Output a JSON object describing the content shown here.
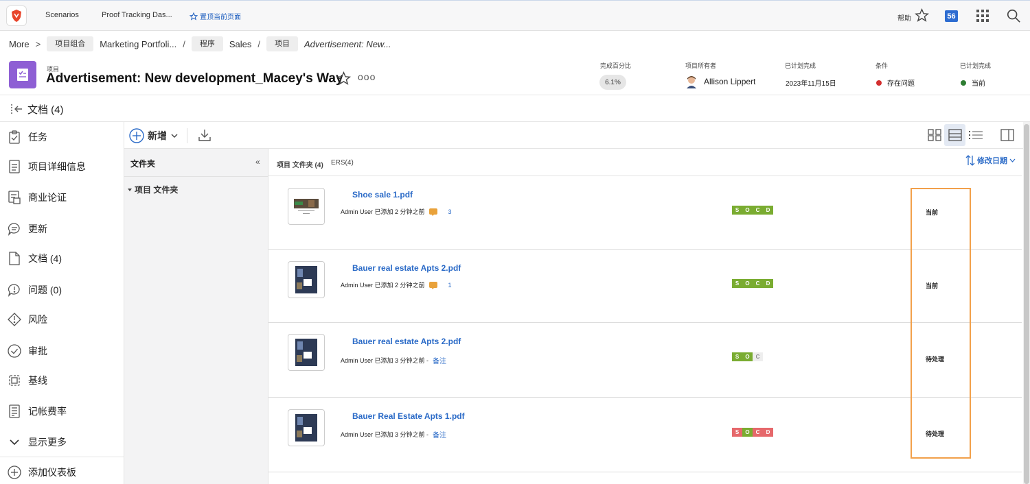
{
  "topnav": {
    "links": [
      "Scenarios",
      "Proof Tracking Das..."
    ],
    "pin_label": "置顶当前页面",
    "help": "帮助",
    "notifications": "56"
  },
  "breadcrumb": {
    "more": "More",
    "portfolio_chip": "项目组合",
    "portfolio": "Marketing Portfoli...",
    "program_chip": "程序",
    "program": "Sales",
    "project_chip": "项目",
    "current": "Advertisement: New..."
  },
  "header": {
    "type": "项目",
    "title": "Advertisement: New development_Macey's Way",
    "more": "ooo",
    "percent_label": "完成百分比",
    "percent": "6.1%",
    "owner_label": "项目所有者",
    "owner": "Allison Lippert",
    "planned_label": "已计划完成",
    "planned": "2023年11月15日",
    "condition_label": "条件",
    "condition": "存在问题",
    "condition_color": "#d32f2f",
    "planned2_label": "已计划完成",
    "planned2": "当前",
    "planned2_color": "#2e7d32"
  },
  "section": {
    "title": "文档 (4)"
  },
  "leftnav": {
    "items": [
      {
        "label": "任务",
        "icon": "clipboard-check-icon"
      },
      {
        "label": "项目详细信息",
        "icon": "document-icon"
      },
      {
        "label": "商业论证",
        "icon": "business-case-icon"
      },
      {
        "label": "更新",
        "icon": "chat-bubble-icon"
      },
      {
        "label": "文档 (4)",
        "icon": "file-icon"
      },
      {
        "label": "问题 (0)",
        "icon": "issue-icon"
      },
      {
        "label": "风险",
        "icon": "risk-icon"
      },
      {
        "label": "审批",
        "icon": "approval-icon"
      },
      {
        "label": "基线",
        "icon": "baseline-icon"
      },
      {
        "label": "记帐费率",
        "icon": "billing-rate-icon"
      },
      {
        "label": "显示更多",
        "icon": "chevron-down-icon"
      }
    ],
    "add_dashboard": "添加仪表板"
  },
  "toolbar": {
    "new_label": "新增"
  },
  "folders": {
    "heading": "文件夹",
    "items": [
      "项目 文件夹"
    ]
  },
  "list": {
    "tab_project": "项目 文件夹 (4)",
    "tab_ers": "ERS(4)",
    "sort_label": "修改日期",
    "docs": [
      {
        "name": "Shoe sale 1.pdf",
        "meta": "Admin User 已添加 2 分钟之前",
        "comments": "3",
        "note": "",
        "socd": [
          "S",
          "O",
          "C",
          "D"
        ],
        "socd_colors": [
          "g",
          "g",
          "g",
          "g"
        ],
        "status": "当前"
      },
      {
        "name": "Bauer real estate Apts 2.pdf",
        "meta": "Admin User 已添加 2 分钟之前",
        "comments": "1",
        "note": "",
        "socd": [
          "S",
          "O",
          "C",
          "D"
        ],
        "socd_colors": [
          "g",
          "g",
          "g",
          "g"
        ],
        "status": "当前"
      },
      {
        "name": "Bauer real estate Apts 2.pdf",
        "meta": "Admin User 已添加 3 分钟之前 -",
        "comments": "",
        "note": "备注",
        "socd": [
          "S",
          "O",
          "C"
        ],
        "socd_colors": [
          "g",
          "g",
          "gr"
        ],
        "status": "待处理"
      },
      {
        "name": "Bauer Real Estate Apts 1.pdf",
        "meta": "Admin User 已添加 3 分钟之前 -",
        "comments": "",
        "note": "备注",
        "socd": [
          "S",
          "O",
          "C",
          "D"
        ],
        "socd_colors": [
          "r",
          "g",
          "r",
          "r"
        ],
        "status": "待处理"
      }
    ]
  }
}
